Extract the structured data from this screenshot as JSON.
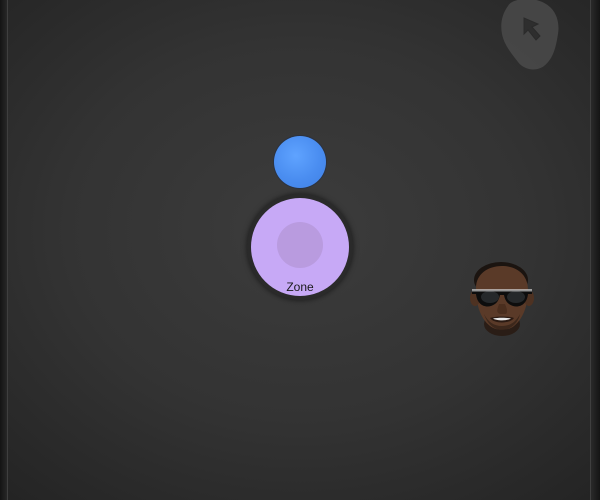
{
  "game": {
    "zone": {
      "label": "Zone"
    },
    "colors": {
      "background": "#333333",
      "ball": "#4a8df0",
      "zone_fill": "#c7a9f6",
      "zone_core": "#b99bdf",
      "zone_ring": "#2a2a2a"
    },
    "icons": {
      "corner": "pointer-hand-icon",
      "player": "face-avatar-icon",
      "ball": "blue-ball"
    }
  }
}
